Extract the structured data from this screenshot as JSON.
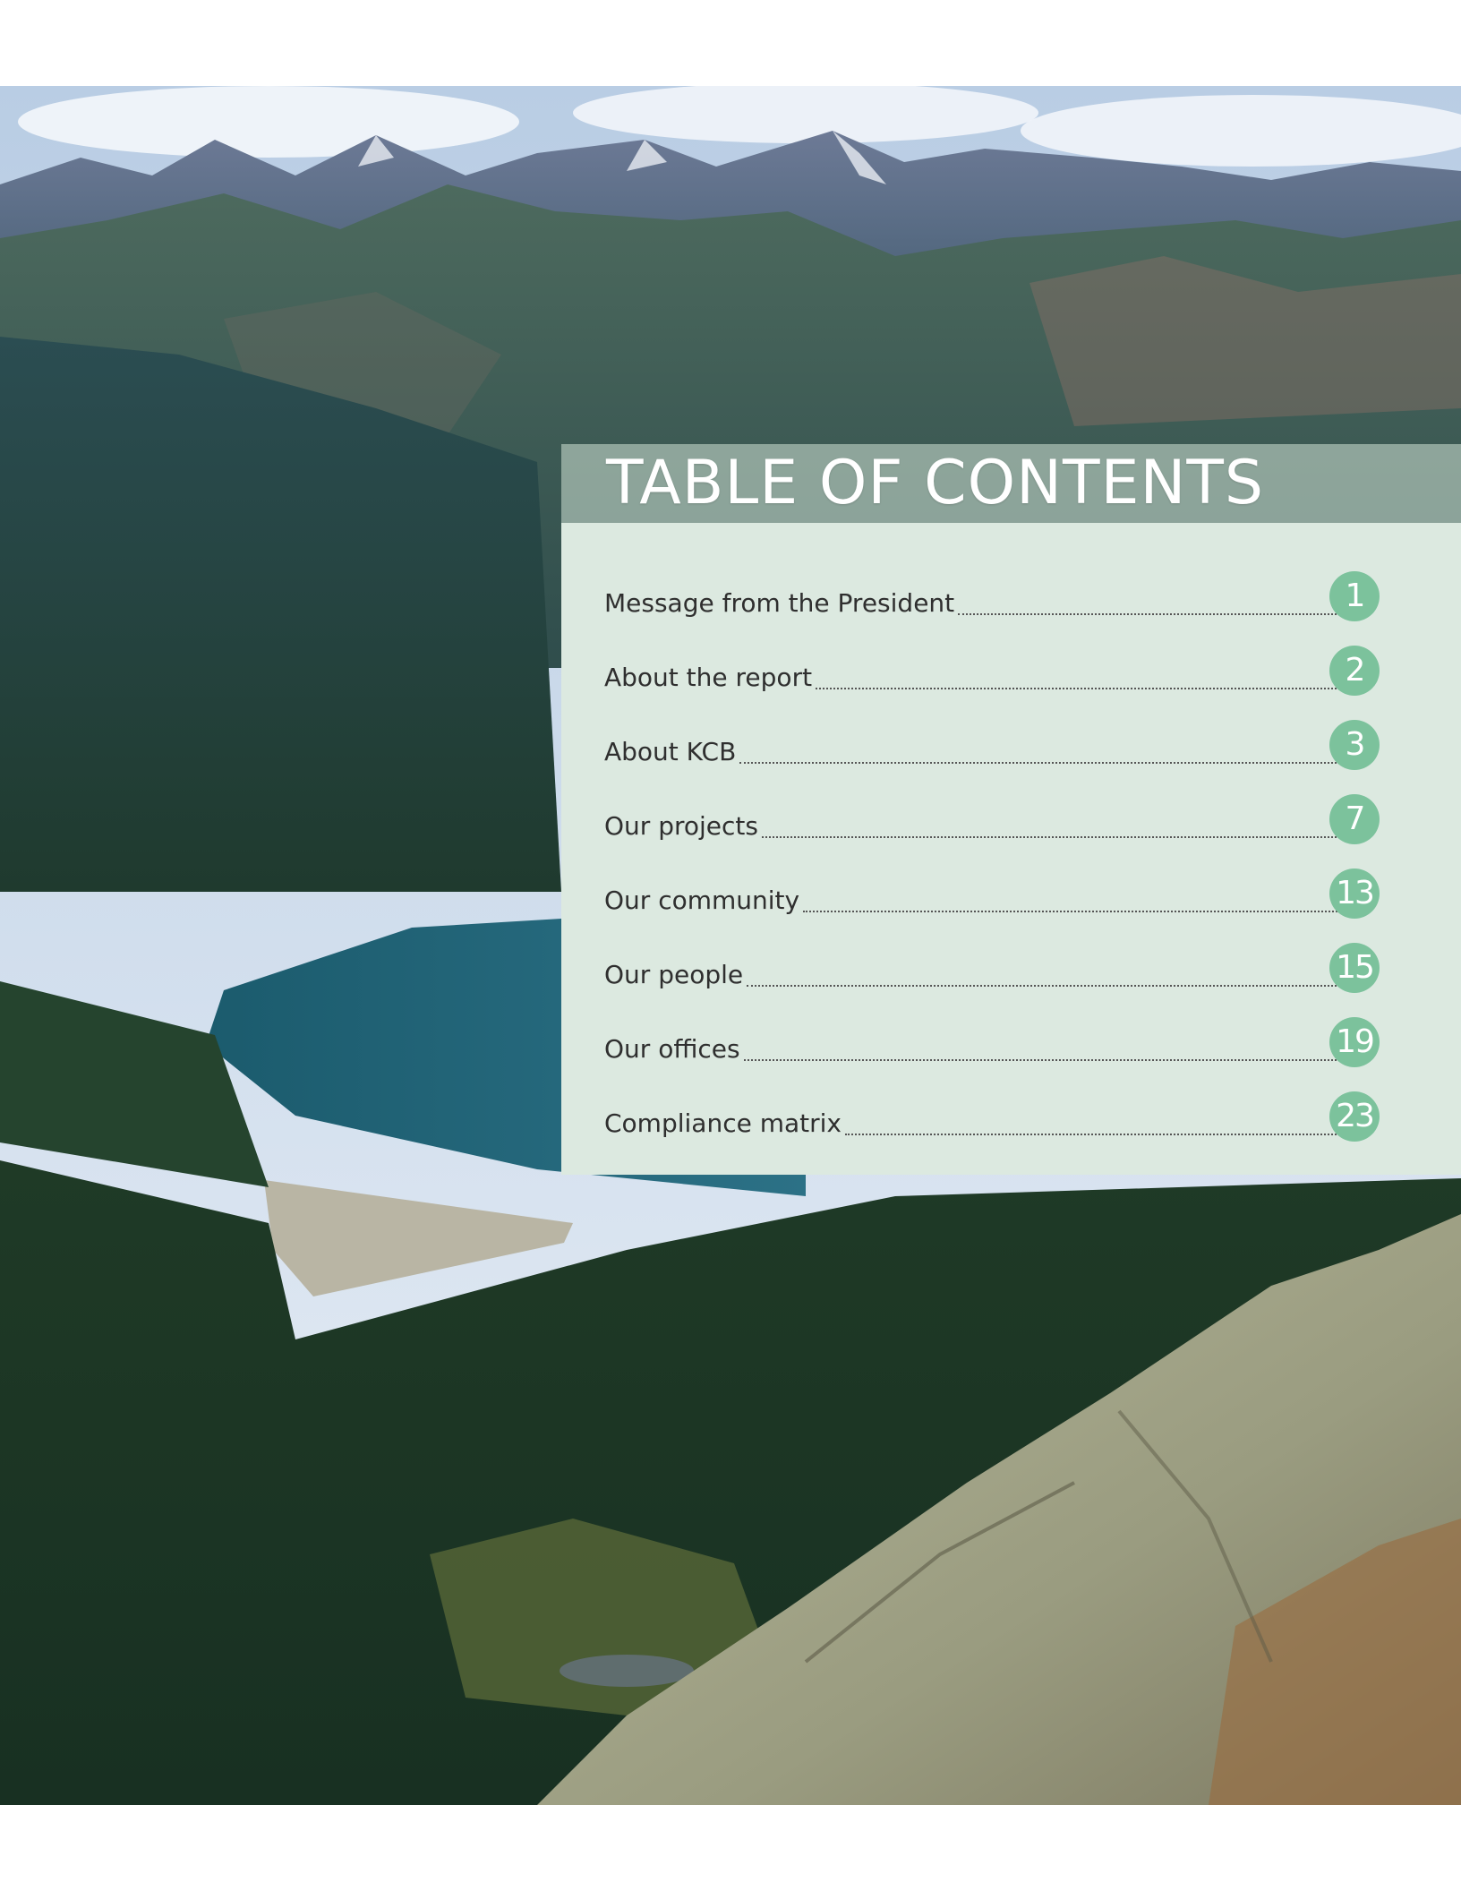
{
  "header": {
    "title": "TABLE OF CONTENTS"
  },
  "toc": [
    {
      "label": "Message from the President",
      "page": "1"
    },
    {
      "label": "About the report",
      "page": "2"
    },
    {
      "label": "About KCB",
      "page": "3"
    },
    {
      "label": "Our projects",
      "page": "7"
    },
    {
      "label": "Our community",
      "page": "13"
    },
    {
      "label": "Our people",
      "page": "15"
    },
    {
      "label": "Our offices",
      "page": "19"
    },
    {
      "label": "Compliance matrix",
      "page": "23"
    }
  ],
  "colors": {
    "panel": "#dce9e0",
    "badge": "#7cc29c",
    "title_text": "#ffffff"
  }
}
